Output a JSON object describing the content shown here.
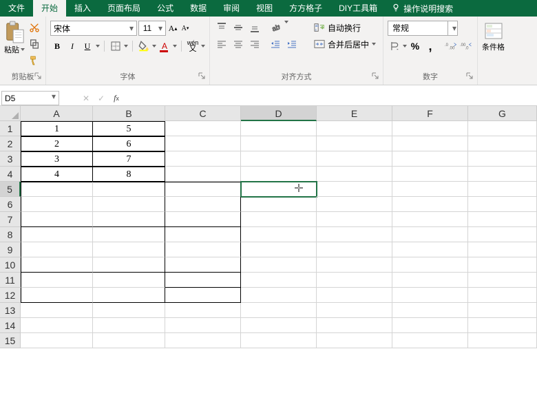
{
  "tabs": {
    "file": "文件",
    "home": "开始",
    "insert": "插入",
    "pageLayout": "页面布局",
    "formulas": "公式",
    "data": "数据",
    "review": "审阅",
    "view": "视图",
    "ffgz": "方方格子",
    "diy": "DIY工具箱",
    "search": "操作说明搜索"
  },
  "ribbon": {
    "clipboard": {
      "paste": "粘贴",
      "label": "剪贴板"
    },
    "font": {
      "name": "宋体",
      "size": "11",
      "label": "字体",
      "ruby": "wén",
      "bold": "B",
      "italic": "I",
      "underline": "U"
    },
    "align": {
      "wrap": "自动换行",
      "merge": "合并后居中",
      "label": "对齐方式"
    },
    "number": {
      "format": "常规",
      "label": "数字",
      "pct": "%",
      "comma": ","
    },
    "cond": {
      "label": "条件格"
    }
  },
  "bar": {
    "name": "D5"
  },
  "grid": {
    "colWidths": {
      "A": 105,
      "B": 105,
      "C": 110,
      "D": 110,
      "E": 110,
      "F": 110,
      "G": 100
    },
    "cols": [
      "A",
      "B",
      "C",
      "D",
      "E",
      "F",
      "G"
    ],
    "rows": 15,
    "data": {
      "A1": "1",
      "B1": "5",
      "A2": "2",
      "B2": "6",
      "A3": "3",
      "B3": "7",
      "A4": "4",
      "B4": "8"
    },
    "selCell": "D5",
    "selCol": "D",
    "selRow": 5
  }
}
